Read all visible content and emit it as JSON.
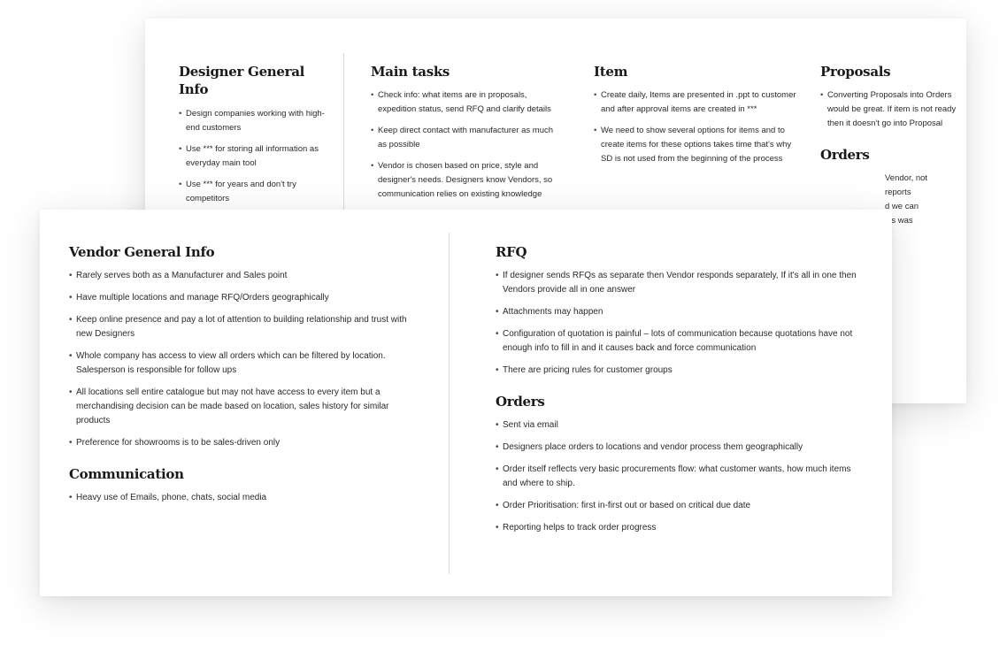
{
  "back_card": {
    "designer_general_info": {
      "title": "Designer General Info",
      "items": [
        "Design companies working with high-end customers",
        "Use *** for storing all information as everyday main tool",
        "Use *** for years and don't try competitors"
      ]
    },
    "main_tasks": {
      "title": "Main tasks",
      "items": [
        "Check info: what items are in proposals, expedition status, send RFQ and clarify details",
        "Keep direct contact with manufacturer as much as possible",
        "Vendor is chosen based on price, style and designer's needs. Designers know Vendors, so communication relies on existing knowledge"
      ]
    },
    "item": {
      "title": "Item",
      "items": [
        "Create daily, Items are presented in .ppt to customer and after approval items are created in ***",
        "We need to show several options for items and to create items for these options takes time that's why SD is not used from the beginning of the process"
      ]
    },
    "proposals": {
      "title": "Proposals",
      "items": [
        "Converting Proposals into Orders would be great. If item is not ready then it doesn't go into Proposal"
      ]
    },
    "orders": {
      "title": "Orders",
      "partial_lines": [
        "Vendor, not",
        "reports",
        "d we can",
        "les was"
      ]
    }
  },
  "front_card": {
    "vendor_general_info": {
      "title": "Vendor General Info",
      "items": [
        "Rarely serves both as a Manufacturer and Sales point",
        "Have multiple locations and manage RFQ/Orders geographically",
        "Keep online presence and pay a lot of attention to building relationship and trust with new Designers",
        "Whole company has access to view all orders which can be filtered by location. Salesperson is responsible for follow ups",
        "All locations sell entire catalogue but may not have access to every item but a merchandising decision can be made based on location, sales history for similar products",
        "Preference for showrooms is to be sales-driven only"
      ]
    },
    "communication": {
      "title": "Communication",
      "items": [
        "Heavy use of Emails, phone, chats, social media"
      ]
    },
    "rfq": {
      "title": "RFQ",
      "items": [
        "If designer sends RFQs as separate then Vendor responds separately, If it's all in one then Vendors provide all in one answer",
        "Attachments may happen",
        "Configuration of quotation is painful – lots of communication because quotations have not enough info to fill in and it causes back and force communication",
        "There are pricing rules for customer groups"
      ]
    },
    "orders": {
      "title": "Orders",
      "items": [
        "Sent via email",
        "Designers place orders to locations and vendor process them geographically",
        "Order itself reflects very basic procurements flow: what customer wants, how much items and where to ship.",
        "Order Prioritisation: first in-first out or based on critical due date",
        "Reporting helps to track order progress"
      ]
    }
  }
}
